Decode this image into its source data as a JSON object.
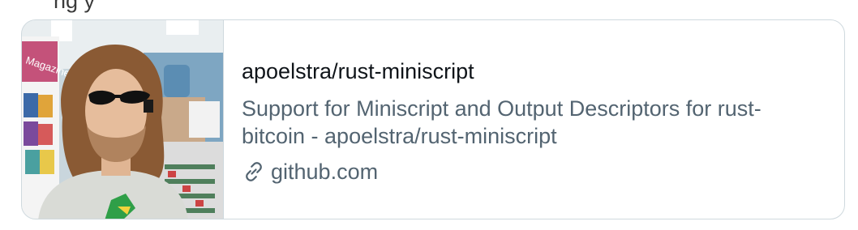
{
  "header_fragment": "ng          y",
  "card": {
    "title": "apoelstra/rust-miniscript",
    "description": "Support for Miniscript and Output Descriptors for rust-bitcoin - apoelstra/rust-miniscript",
    "domain": "github.com",
    "domain_icon": "link-icon",
    "thumbnail_sign_text": "Magazines"
  },
  "colors": {
    "title": "#0f1419",
    "secondary": "#536471",
    "border": "#cfd9de"
  }
}
